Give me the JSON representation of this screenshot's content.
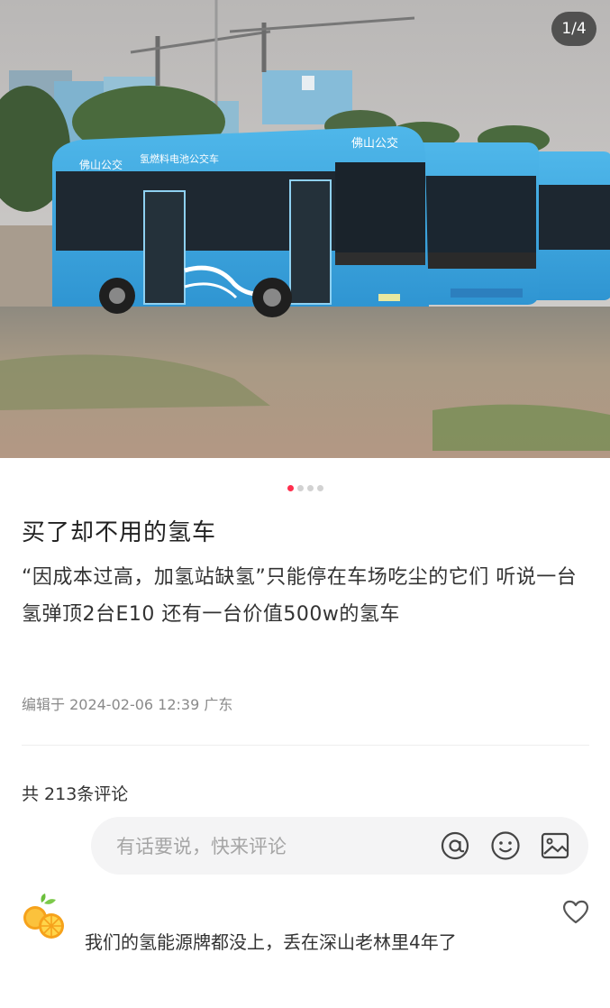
{
  "photo": {
    "counter": "1/4",
    "alt_label": "hydrogen fuel cell buses parked in a lot",
    "bus_roof_text": "佛山公交",
    "bus_side_text": "氢燃料电池公交车",
    "bus_front_text": "佛山公交"
  },
  "pager": {
    "total": 4,
    "active_index": 0
  },
  "post": {
    "title": "买了却不用的氢车",
    "body": "“因成本过高，加氢站缺氢”只能停在车场吃尘的它们  听说一台氢弹顶2台E10 还有一台价值500w的氢车",
    "meta": "编辑于 2024-02-06 12:39 广东"
  },
  "comments": {
    "count_label": "共 213条评论",
    "input_placeholder": "有话要说，快来评论",
    "icons": [
      "at-icon",
      "emoji-icon",
      "image-icon"
    ],
    "items": [
      {
        "text": "我们的氢能源牌都没上，丢在深山老林里4年了",
        "avatar": "orange-slice-avatar"
      }
    ]
  },
  "colors": {
    "accent": "#ff2e4d",
    "bus": "#3fa9e0",
    "bus_dark": "#2c83c2"
  }
}
